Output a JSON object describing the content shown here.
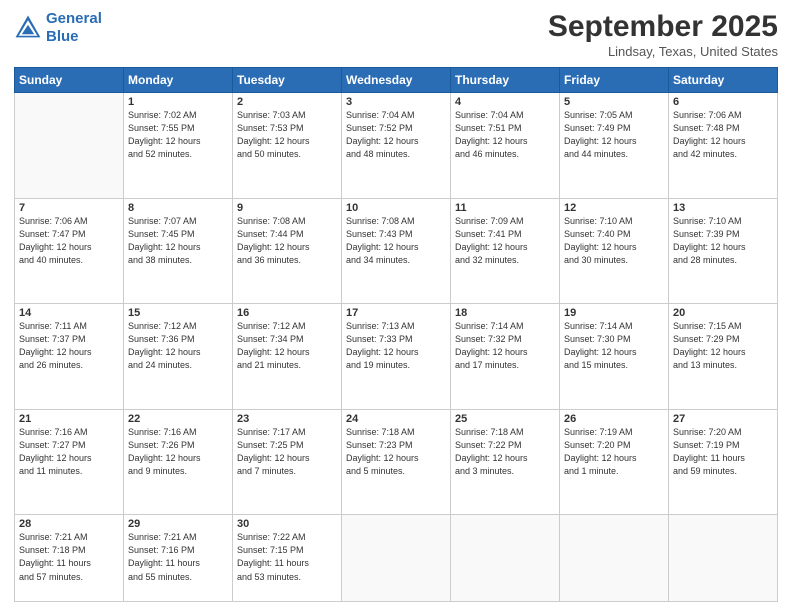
{
  "header": {
    "logo_line1": "General",
    "logo_line2": "Blue",
    "month_title": "September 2025",
    "subtitle": "Lindsay, Texas, United States"
  },
  "weekdays": [
    "Sunday",
    "Monday",
    "Tuesday",
    "Wednesday",
    "Thursday",
    "Friday",
    "Saturday"
  ],
  "weeks": [
    [
      {
        "day": "",
        "info": ""
      },
      {
        "day": "1",
        "info": "Sunrise: 7:02 AM\nSunset: 7:55 PM\nDaylight: 12 hours\nand 52 minutes."
      },
      {
        "day": "2",
        "info": "Sunrise: 7:03 AM\nSunset: 7:53 PM\nDaylight: 12 hours\nand 50 minutes."
      },
      {
        "day": "3",
        "info": "Sunrise: 7:04 AM\nSunset: 7:52 PM\nDaylight: 12 hours\nand 48 minutes."
      },
      {
        "day": "4",
        "info": "Sunrise: 7:04 AM\nSunset: 7:51 PM\nDaylight: 12 hours\nand 46 minutes."
      },
      {
        "day": "5",
        "info": "Sunrise: 7:05 AM\nSunset: 7:49 PM\nDaylight: 12 hours\nand 44 minutes."
      },
      {
        "day": "6",
        "info": "Sunrise: 7:06 AM\nSunset: 7:48 PM\nDaylight: 12 hours\nand 42 minutes."
      }
    ],
    [
      {
        "day": "7",
        "info": "Sunrise: 7:06 AM\nSunset: 7:47 PM\nDaylight: 12 hours\nand 40 minutes."
      },
      {
        "day": "8",
        "info": "Sunrise: 7:07 AM\nSunset: 7:45 PM\nDaylight: 12 hours\nand 38 minutes."
      },
      {
        "day": "9",
        "info": "Sunrise: 7:08 AM\nSunset: 7:44 PM\nDaylight: 12 hours\nand 36 minutes."
      },
      {
        "day": "10",
        "info": "Sunrise: 7:08 AM\nSunset: 7:43 PM\nDaylight: 12 hours\nand 34 minutes."
      },
      {
        "day": "11",
        "info": "Sunrise: 7:09 AM\nSunset: 7:41 PM\nDaylight: 12 hours\nand 32 minutes."
      },
      {
        "day": "12",
        "info": "Sunrise: 7:10 AM\nSunset: 7:40 PM\nDaylight: 12 hours\nand 30 minutes."
      },
      {
        "day": "13",
        "info": "Sunrise: 7:10 AM\nSunset: 7:39 PM\nDaylight: 12 hours\nand 28 minutes."
      }
    ],
    [
      {
        "day": "14",
        "info": "Sunrise: 7:11 AM\nSunset: 7:37 PM\nDaylight: 12 hours\nand 26 minutes."
      },
      {
        "day": "15",
        "info": "Sunrise: 7:12 AM\nSunset: 7:36 PM\nDaylight: 12 hours\nand 24 minutes."
      },
      {
        "day": "16",
        "info": "Sunrise: 7:12 AM\nSunset: 7:34 PM\nDaylight: 12 hours\nand 21 minutes."
      },
      {
        "day": "17",
        "info": "Sunrise: 7:13 AM\nSunset: 7:33 PM\nDaylight: 12 hours\nand 19 minutes."
      },
      {
        "day": "18",
        "info": "Sunrise: 7:14 AM\nSunset: 7:32 PM\nDaylight: 12 hours\nand 17 minutes."
      },
      {
        "day": "19",
        "info": "Sunrise: 7:14 AM\nSunset: 7:30 PM\nDaylight: 12 hours\nand 15 minutes."
      },
      {
        "day": "20",
        "info": "Sunrise: 7:15 AM\nSunset: 7:29 PM\nDaylight: 12 hours\nand 13 minutes."
      }
    ],
    [
      {
        "day": "21",
        "info": "Sunrise: 7:16 AM\nSunset: 7:27 PM\nDaylight: 12 hours\nand 11 minutes."
      },
      {
        "day": "22",
        "info": "Sunrise: 7:16 AM\nSunset: 7:26 PM\nDaylight: 12 hours\nand 9 minutes."
      },
      {
        "day": "23",
        "info": "Sunrise: 7:17 AM\nSunset: 7:25 PM\nDaylight: 12 hours\nand 7 minutes."
      },
      {
        "day": "24",
        "info": "Sunrise: 7:18 AM\nSunset: 7:23 PM\nDaylight: 12 hours\nand 5 minutes."
      },
      {
        "day": "25",
        "info": "Sunrise: 7:18 AM\nSunset: 7:22 PM\nDaylight: 12 hours\nand 3 minutes."
      },
      {
        "day": "26",
        "info": "Sunrise: 7:19 AM\nSunset: 7:20 PM\nDaylight: 12 hours\nand 1 minute."
      },
      {
        "day": "27",
        "info": "Sunrise: 7:20 AM\nSunset: 7:19 PM\nDaylight: 11 hours\nand 59 minutes."
      }
    ],
    [
      {
        "day": "28",
        "info": "Sunrise: 7:21 AM\nSunset: 7:18 PM\nDaylight: 11 hours\nand 57 minutes."
      },
      {
        "day": "29",
        "info": "Sunrise: 7:21 AM\nSunset: 7:16 PM\nDaylight: 11 hours\nand 55 minutes."
      },
      {
        "day": "30",
        "info": "Sunrise: 7:22 AM\nSunset: 7:15 PM\nDaylight: 11 hours\nand 53 minutes."
      },
      {
        "day": "",
        "info": ""
      },
      {
        "day": "",
        "info": ""
      },
      {
        "day": "",
        "info": ""
      },
      {
        "day": "",
        "info": ""
      }
    ]
  ]
}
